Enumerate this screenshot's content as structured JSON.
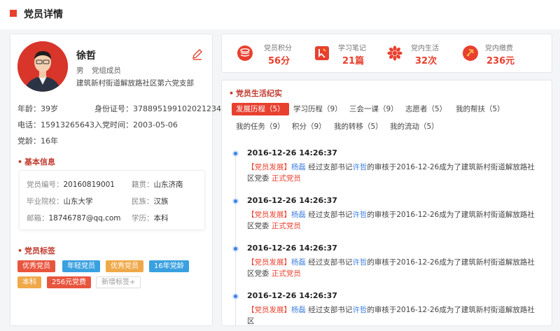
{
  "page": {
    "title": "党员详情"
  },
  "profile": {
    "name": "徐哲",
    "gender": "男",
    "role": "党组成员",
    "branch": "建筑新村街道解放路社区第六党支部",
    "age_label": "年龄：",
    "age": "39岁",
    "id_label": "身份证号：",
    "id": "378895199102021234",
    "phone_label": "电话：",
    "phone": "15913265643",
    "join_label": "入党时间：",
    "join_date": "2003-05-06",
    "party_age_label": "党龄：",
    "party_age": "16年"
  },
  "basic_info": {
    "title": "基本信息",
    "member_no_label": "党员编号：",
    "member_no": "20160819001",
    "native_label": "籍贯：",
    "native": "山东济南",
    "school_label": "毕业院校：",
    "school": "山东大学",
    "ethnic_label": "民族：",
    "ethnic": "汉族",
    "email_label": "邮箱：",
    "email": "18746787@qq.com",
    "edu_label": "学历：",
    "edu": "本科"
  },
  "tags": {
    "title": "党员标签",
    "items": [
      {
        "label": "优秀党员",
        "color": "#e8553e"
      },
      {
        "label": "年轻党员",
        "color": "#3aa1e0"
      },
      {
        "label": "优秀党员",
        "color": "#f0a94a"
      },
      {
        "label": "16年党龄",
        "color": "#3aa1e0"
      },
      {
        "label": "本科",
        "color": "#f0a94a"
      },
      {
        "label": "256元党费",
        "color": "#e8553e"
      }
    ],
    "add_label": "新增标签+"
  },
  "stats": [
    {
      "label": "党员积分",
      "value": "56分",
      "icon": "coins-icon"
    },
    {
      "label": "学习笔记",
      "value": "21篇",
      "icon": "notes-icon"
    },
    {
      "label": "党内生活",
      "value": "32次",
      "icon": "party-life-icon"
    },
    {
      "label": "党内缴费",
      "value": "236元",
      "icon": "party-fee-icon"
    }
  ],
  "life": {
    "title": "党员生活纪实",
    "tabs_row1": [
      {
        "label": "发展历程（5）"
      },
      {
        "label": "学习历程（9）"
      },
      {
        "label": "三会一课（9）"
      },
      {
        "label": "志愿者（5）"
      },
      {
        "label": "我的帮扶（5）"
      }
    ],
    "tabs_row2": [
      {
        "label": "我的任务（9）"
      },
      {
        "label": "积分（9）"
      },
      {
        "label": "我的转移（5）"
      },
      {
        "label": "我的流动（5）"
      }
    ],
    "timeline": [
      {
        "time": "2016-12-26  14:26:37",
        "kind": "【党员发展】",
        "p1": "杨磊",
        "mid1": " 经过支部书记",
        "p2": "许哲",
        "mid2": "的审核于2016-12-26成为了建筑新村街道解放路社区党委 ",
        "status": "正式党员"
      },
      {
        "time": "2016-12-26  14:26:37",
        "kind": "【党员发展】",
        "p1": "杨磊",
        "mid1": " 经过支部书记",
        "p2": "许哲",
        "mid2": "的审核于2016-12-26成为了建筑新村街道解放路社区党委 ",
        "status": "正式党员"
      },
      {
        "time": "2016-12-26  14:26:37",
        "kind": "【党员发展】",
        "p1": "杨磊",
        "mid1": " 经过支部书记",
        "p2": "许哲",
        "mid2": "的审核于2016-12-26成为了建筑新村街道解放路社区党委 ",
        "status": "正式党员"
      },
      {
        "time": "2016-12-26  14:26:37",
        "kind": "【党员发展】",
        "p1": "杨磊",
        "mid1": " 经过支部书记",
        "p2": "许哲",
        "mid2": "的审核于2016-12-26成为了建筑新村街道解放路社区",
        "status": ""
      }
    ]
  }
}
